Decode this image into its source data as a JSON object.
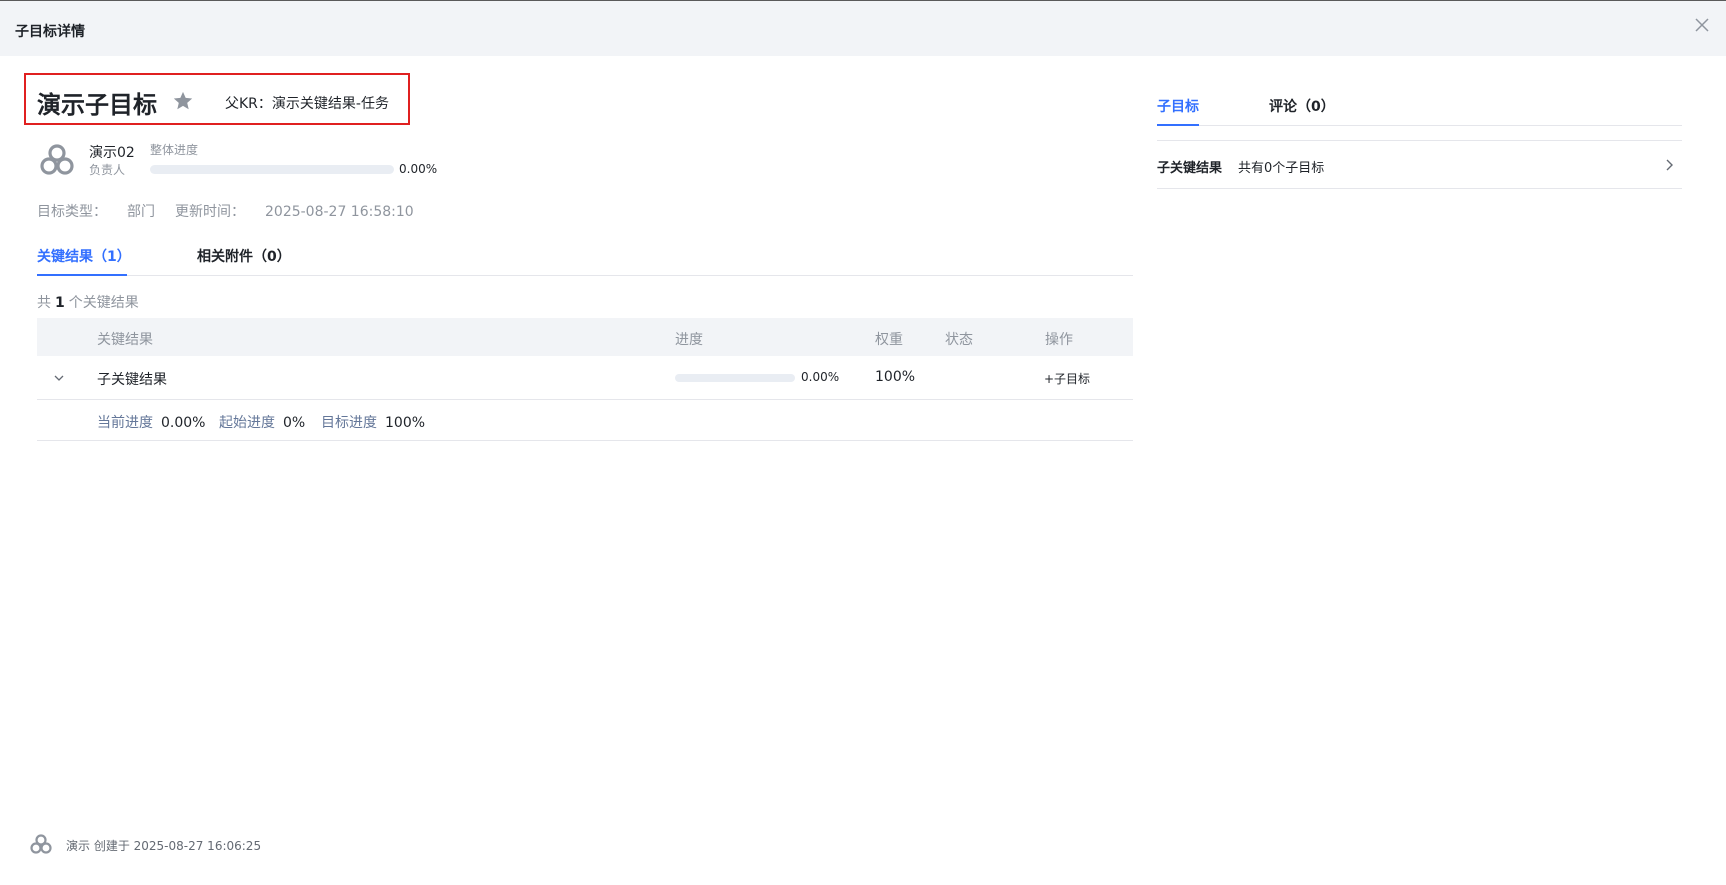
{
  "dialog": {
    "title": "子目标详情"
  },
  "goal": {
    "title": "演示子目标",
    "parent_kr_label": "父KR：",
    "parent_kr_value": "演示关键结果-任务",
    "owner_name": "演示02",
    "owner_role": "负责人",
    "overall_label": "整体进度",
    "overall_progress_text": "0.00%",
    "overall_progress_fraction": 0,
    "type_label": "目标类型：",
    "type_value": "部门",
    "updated_label": "更新时间：",
    "updated_value": "2025-08-27 16:58:10"
  },
  "tabs": [
    {
      "label": "关键结果（1）",
      "active": true
    },
    {
      "label": "相关附件（0）",
      "active": false
    }
  ],
  "kr_count": {
    "prefix": "共",
    "count": "1",
    "suffix": "个关键结果"
  },
  "table": {
    "headers": {
      "kr": "关键结果",
      "progress": "进度",
      "weight": "权重",
      "status": "状态",
      "action": "操作"
    },
    "rows": [
      {
        "name": "子关键结果",
        "progress_text": "0.00%",
        "progress_fraction": 0,
        "weight": "100%",
        "status": "",
        "action": "+子目标",
        "details": {
          "current_label": "当前进度",
          "current_value": "0.00%",
          "start_label": "起始进度",
          "start_value": "0%",
          "target_label": "目标进度",
          "target_value": "100%"
        }
      }
    ]
  },
  "right_panel": {
    "tabs": [
      {
        "label": "子目标",
        "active": true
      },
      {
        "label": "评论（0）",
        "active": false
      }
    ],
    "subgoal_row": {
      "label": "子关键结果",
      "count": "共有0个子目标"
    }
  },
  "footer": {
    "text": "演示 创建于 2025-08-27 16:06:25"
  },
  "colors": {
    "accent": "#3370ff",
    "highlight_border": "#e02020",
    "header_bg": "#f2f4f7"
  },
  "icons": [
    "close-icon",
    "star-icon",
    "avatar-logo-icon",
    "chevron-down-icon",
    "chevron-right-icon"
  ]
}
